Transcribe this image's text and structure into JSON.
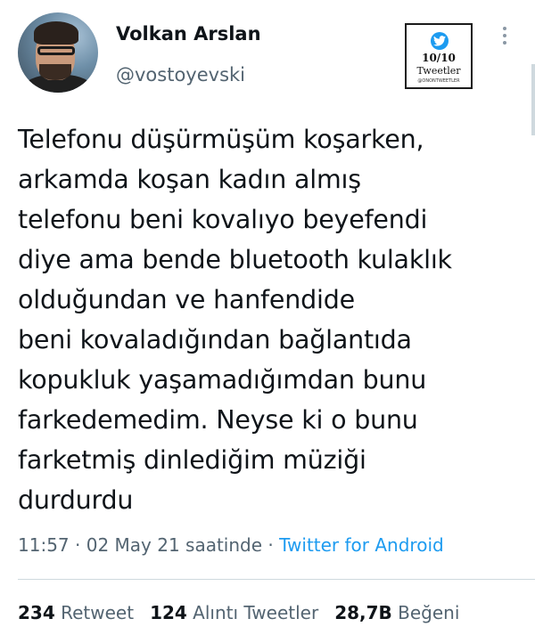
{
  "author": {
    "display_name": "Volkan Arslan",
    "handle": "@vostoyevski",
    "avatar": "profile-photo"
  },
  "badge": {
    "score": "10/10",
    "label": "Tweetler",
    "footer": "@ONONTWEETLER",
    "icon": "twitter-bird-icon"
  },
  "menu": {
    "icon": "more-vertical-icon"
  },
  "tweet": {
    "lines": [
      "Telefonu düşürmüşüm koşarken,",
      "arkamda koşan kadın almış",
      "telefonu beni kovalıyo beyefendi",
      "diye ama bende bluetooth kulaklık",
      "olduğundan ve hanfendide",
      "beni kovaladığından bağlantıda",
      "kopukluk yaşamadığımdan bunu",
      "farkedemedim. Neyse ki o bunu",
      "farketmiş dinlediğim müziği",
      "durdurdu"
    ]
  },
  "meta": {
    "time": "11:57",
    "separator": " · ",
    "date": "02 May 21 saatinde",
    "source": "Twitter for Android"
  },
  "stats": {
    "retweets": {
      "count": "234",
      "label": "Retweet"
    },
    "quotes": {
      "count": "124",
      "label": "Alıntı Tweetler"
    },
    "likes": {
      "count": "28,7B",
      "label": "Beğeni"
    }
  },
  "colors": {
    "text": "#0f1419",
    "secondary": "#536471",
    "link": "#1d9bf0",
    "divider": "#cfd9de"
  }
}
